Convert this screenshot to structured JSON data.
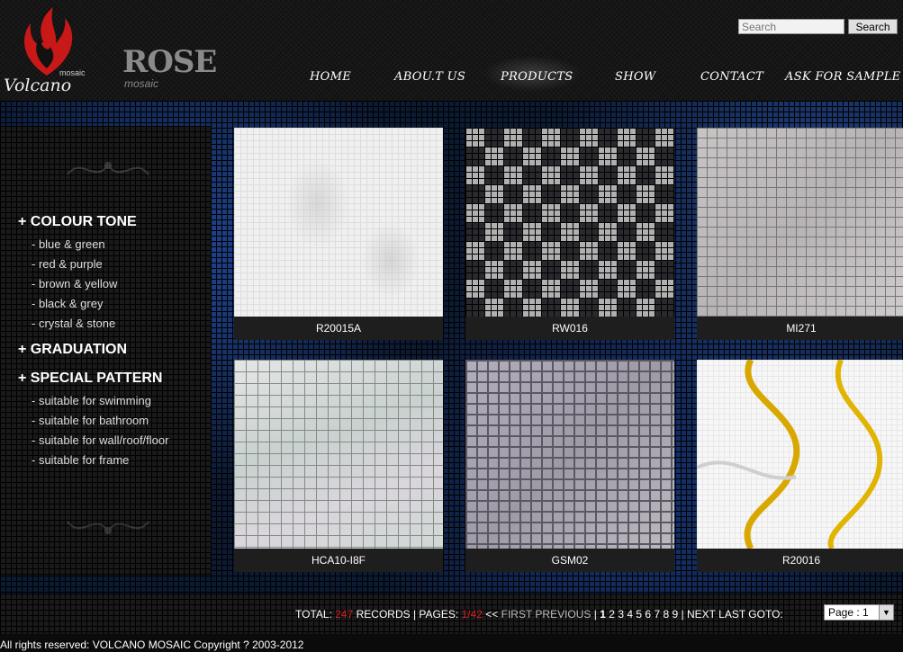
{
  "brand": {
    "logo_text": "Volcano",
    "logo_sub": "mosaic",
    "second_logo": "ROSE",
    "second_logo_sub": "mosaic"
  },
  "search": {
    "placeholder": "Search",
    "button_label": "Search"
  },
  "nav": [
    "HOME",
    "ABOU.T US",
    "PRODUCTS",
    "SHOW",
    "CONTACT",
    "ASK FOR SAMPLE"
  ],
  "sidebar": {
    "categories": [
      {
        "label": "+ COLOUR TONE",
        "items": [
          "- blue & green",
          "- red & purple",
          "- brown & yellow",
          "- black & grey",
          "- crystal & stone"
        ]
      },
      {
        "label": "+ GRADUATION",
        "items": []
      },
      {
        "label": "+ SPECIAL PATTERN",
        "items": [
          "- suitable for swimming",
          "- suitable for bathroom",
          "- suitable for wall/roof/floor",
          "- suitable for frame"
        ]
      }
    ]
  },
  "products": [
    "R20015A",
    "RW016",
    "MI271",
    "HCA10-I8F",
    "GSM02",
    "R20016"
  ],
  "pager": {
    "total_label": "TOTAL:",
    "total_value": "247",
    "records_label": "RECORDS | PAGES:",
    "pages_value": "1/42",
    "prev_arrows": "<<",
    "first": "FIRST",
    "previous": "PREVIOUS",
    "sep": "|",
    "pages": [
      "1",
      "2",
      "3",
      "4",
      "5",
      "6",
      "7",
      "8",
      "9"
    ],
    "next": "NEXT",
    "last": "LAST",
    "goto_label": "GOTO:",
    "goto_value": "Page : 1"
  },
  "footer": {
    "copyright": "All rights reserved: VOLCANO MOSAIC Copyright ? 2003-2012"
  },
  "colors": {
    "accent_red": "#d62020",
    "background": "#0b0b0b"
  }
}
